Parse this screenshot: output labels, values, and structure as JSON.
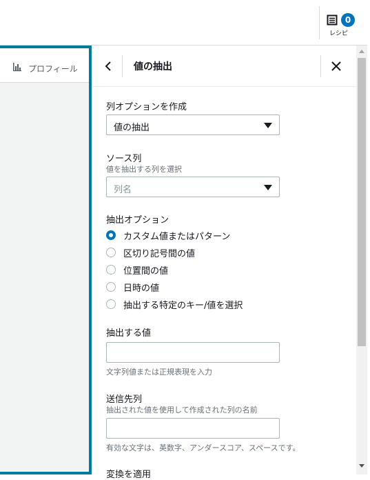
{
  "topbar": {
    "recipe": {
      "label": "レシピ",
      "count": "0",
      "icon": "list-document-icon"
    }
  },
  "left_panel": {
    "tab": {
      "label": "プロフィール",
      "icon": "bar-chart-icon"
    },
    "accent_color": "#007b9a"
  },
  "panel": {
    "title": "値の抽出",
    "back_icon": "chevron-left-icon",
    "close_icon": "close-icon",
    "create_column_option": {
      "label": "列オプションを作成",
      "selected": "値の抽出"
    },
    "source_column": {
      "label": "ソース列",
      "description": "値を抽出する列を選択",
      "placeholder": "列名"
    },
    "extract_options": {
      "label": "抽出オプション",
      "options": [
        {
          "label": "カスタム値またはパターン",
          "checked": true
        },
        {
          "label": "区切り記号間の値",
          "checked": false
        },
        {
          "label": "位置間の値",
          "checked": false
        },
        {
          "label": "日時の値",
          "checked": false
        },
        {
          "label": "抽出する特定のキー/値を選択",
          "checked": false
        }
      ]
    },
    "value_to_extract": {
      "label": "抽出する値",
      "value": "",
      "hint": "文字列値または正規表現を入力"
    },
    "destination_column": {
      "label": "送信先列",
      "description": "抽出された値を使用して作成された列の名前",
      "value": "",
      "hint": "有効な文字は、英数字、アンダースコア、スペースです。"
    },
    "next_section_label": "変換を適用"
  },
  "colors": {
    "accent": "#0073bb",
    "border": "#aab7b8"
  }
}
